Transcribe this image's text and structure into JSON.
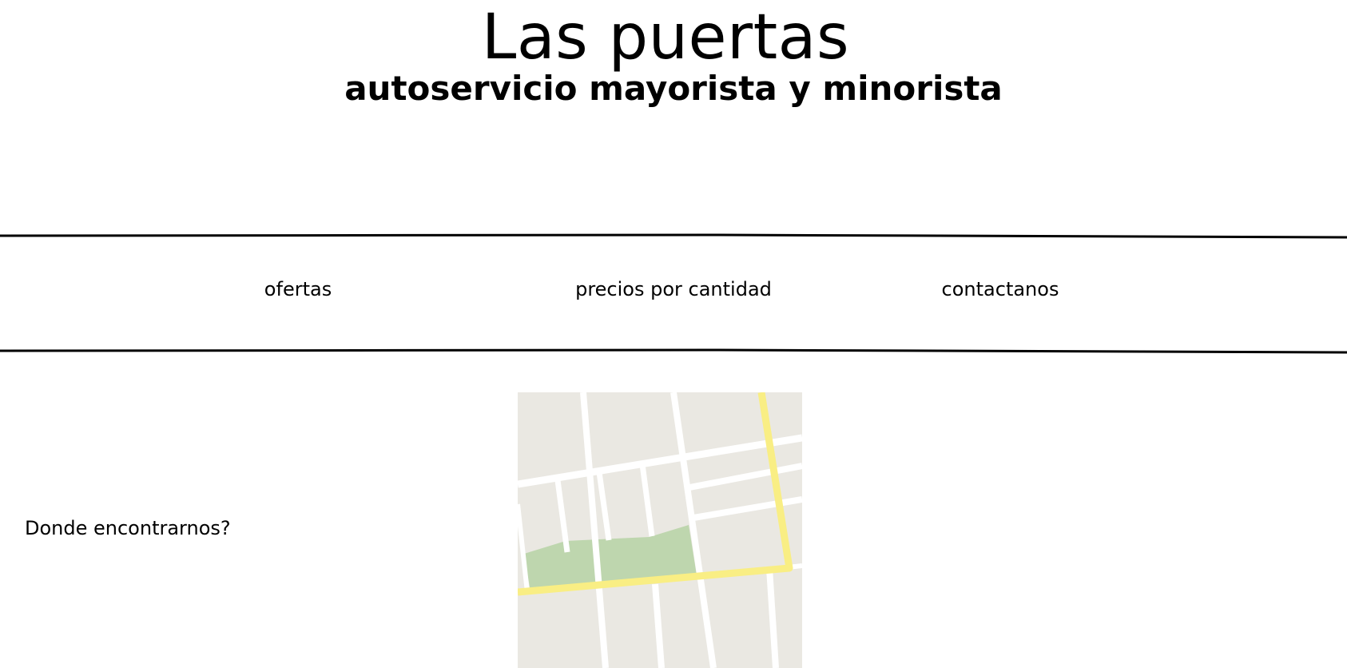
{
  "header": {
    "title": "Las puertas",
    "subtitle": "autoservicio mayorista y minorista"
  },
  "nav": {
    "items": [
      {
        "label": "ofertas"
      },
      {
        "label": "precios por cantidad"
      },
      {
        "label": "contactanos"
      }
    ]
  },
  "location": {
    "label": "Donde encontrarnos?"
  },
  "map": {
    "icon": "street-map",
    "colors": {
      "land": "#eae8e2",
      "street": "#ffffff",
      "main_road": "#f9ee84",
      "park": "#bed6ae"
    }
  }
}
